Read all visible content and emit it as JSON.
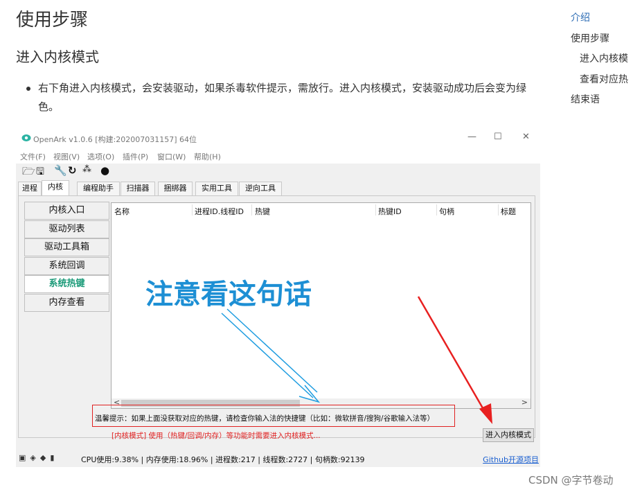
{
  "article": {
    "heading": "使用步骤",
    "subheading": "进入内核模式",
    "bullet": "右下角进入内核模式，会安装驱动，如果杀毒软件提示，需放行。进入内核模式，安装驱动成功后会变为绿色。"
  },
  "toc": {
    "items": [
      "介绍",
      "使用步骤",
      "进入内核模",
      "查看对应热",
      "结束语"
    ]
  },
  "window": {
    "title": "OpenArk v1.0.6  [构建:202007031157]  64位",
    "controls": {
      "minimize": "—",
      "maximize": "☐",
      "close": "✕"
    },
    "menu": [
      "文件(F)",
      "视图(V)",
      "选项(O)",
      "插件(P)",
      "窗口(W)",
      "帮助(H)"
    ],
    "toolbar_icons": [
      "open-folder-icon",
      "save-icon",
      "wrench-icon",
      "refresh-icon",
      "grid-icon",
      "github-icon"
    ],
    "tabs": [
      "进程",
      "内核",
      "编程助手",
      "扫描器",
      "捆绑器",
      "实用工具",
      "逆向工具"
    ],
    "selected_tab": "内核",
    "side_menu": [
      "内核入口",
      "驱动列表",
      "驱动工具箱",
      "系统回调",
      "系统热键",
      "内存查看"
    ],
    "selected_side": "系统热键",
    "columns": [
      "名称",
      "进程ID.线程ID",
      "热键",
      "热键ID",
      "句柄",
      "标题"
    ],
    "notice": "温馨提示：如果上面没获取对应的热键，请检查你输入法的快捷键（比如：微软拼音/搜狗/谷歌输入法等）",
    "warning": "[内核模式] 使用（热键/回调/内存）等功能时需要进入内核模式...",
    "kernel_button": "进入内核模式",
    "status": "CPU使用:9.38% | 内存使用:18.96% | 进程数:217 | 线程数:2727 | 句柄数:92139",
    "github_link": "Github开源项目"
  },
  "annotation": "注意看这句话",
  "watermark": "CSDN @字节卷动",
  "colors": {
    "toc_active": "#2f6eb5",
    "selected_side": "#1a9a78",
    "annotation": "#1d8fd4",
    "warning": "#e02020",
    "link": "#1a5fd0"
  }
}
